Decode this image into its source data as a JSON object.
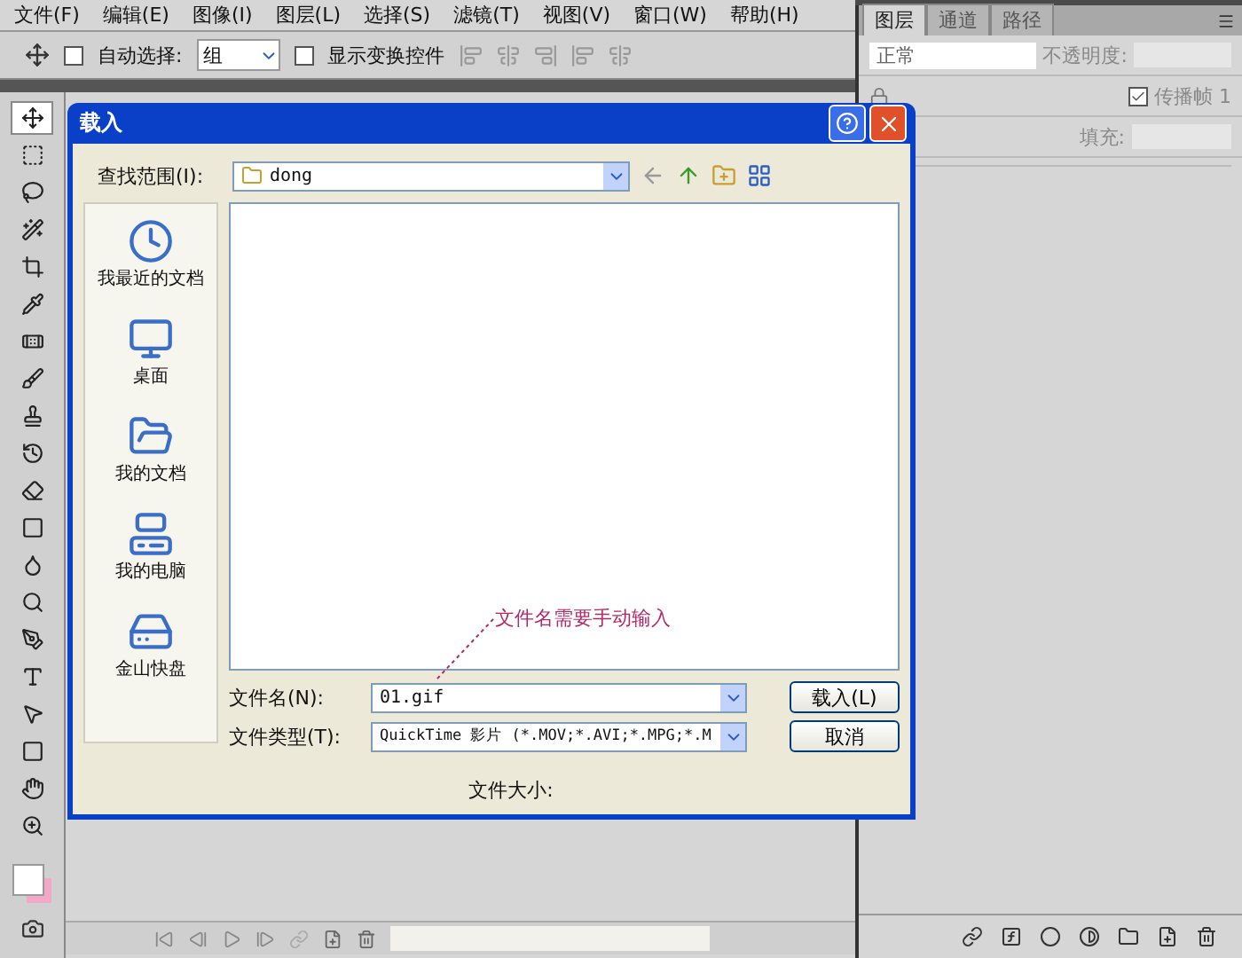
{
  "menu": [
    "文件(F)",
    "编辑(E)",
    "图像(I)",
    "图层(L)",
    "选择(S)",
    "滤镜(T)",
    "视图(V)",
    "窗口(W)",
    "帮助(H)"
  ],
  "options": {
    "auto_select": {
      "label": "自动选择:",
      "checked": false
    },
    "auto_select_value": "组",
    "show_transform": {
      "label": "显示变换控件",
      "checked": false
    }
  },
  "tools": [
    {
      "kind": "move",
      "selected": true
    },
    {
      "kind": "marquee",
      "selected": false
    },
    {
      "kind": "lasso",
      "selected": false
    },
    {
      "kind": "wand",
      "selected": false
    },
    {
      "kind": "crop",
      "selected": false
    },
    {
      "kind": "eyedropper",
      "selected": false
    },
    {
      "kind": "healing",
      "selected": false
    },
    {
      "kind": "brush",
      "selected": false
    },
    {
      "kind": "stamp",
      "selected": false
    },
    {
      "kind": "history",
      "selected": false
    },
    {
      "kind": "eraser",
      "selected": false
    },
    {
      "kind": "gradient",
      "selected": false
    },
    {
      "kind": "blur",
      "selected": false
    },
    {
      "kind": "dodge",
      "selected": false
    },
    {
      "kind": "pen",
      "selected": false
    },
    {
      "kind": "type",
      "selected": false
    },
    {
      "kind": "path",
      "selected": false
    },
    {
      "kind": "shape",
      "selected": false
    },
    {
      "kind": "hand",
      "selected": false
    },
    {
      "kind": "zoom",
      "selected": false
    }
  ],
  "panel": {
    "tabs": [
      {
        "label": "图层",
        "selected": true
      },
      {
        "label": "通道",
        "selected": false
      },
      {
        "label": "路径",
        "selected": false
      }
    ],
    "blend_mode": "正常",
    "opacity_label": "不透明度:",
    "propagate": {
      "label": "传播帧 1",
      "checked": true
    },
    "fill_label": "填充:"
  },
  "dialog": {
    "title": "载入",
    "look_in_label": "查找范围(I):",
    "folder": "dong",
    "places": [
      {
        "kind": "recent",
        "label": "我最近的文档"
      },
      {
        "kind": "desktop",
        "label": "桌面"
      },
      {
        "kind": "documents",
        "label": "我的文档"
      },
      {
        "kind": "computer",
        "label": "我的电脑"
      },
      {
        "kind": "drive",
        "label": "金山快盘"
      }
    ],
    "annotation": "文件名需要手动输入",
    "file_name_label": "文件名(N):",
    "file_name": "01.gif",
    "file_type_label": "文件类型(T):",
    "file_type": "QuickTime 影片 (*.MOV;*.AVI;*.MPG;*.M",
    "buttons": [
      "载入(L)",
      "取消"
    ],
    "file_size_label": "文件大小:"
  }
}
